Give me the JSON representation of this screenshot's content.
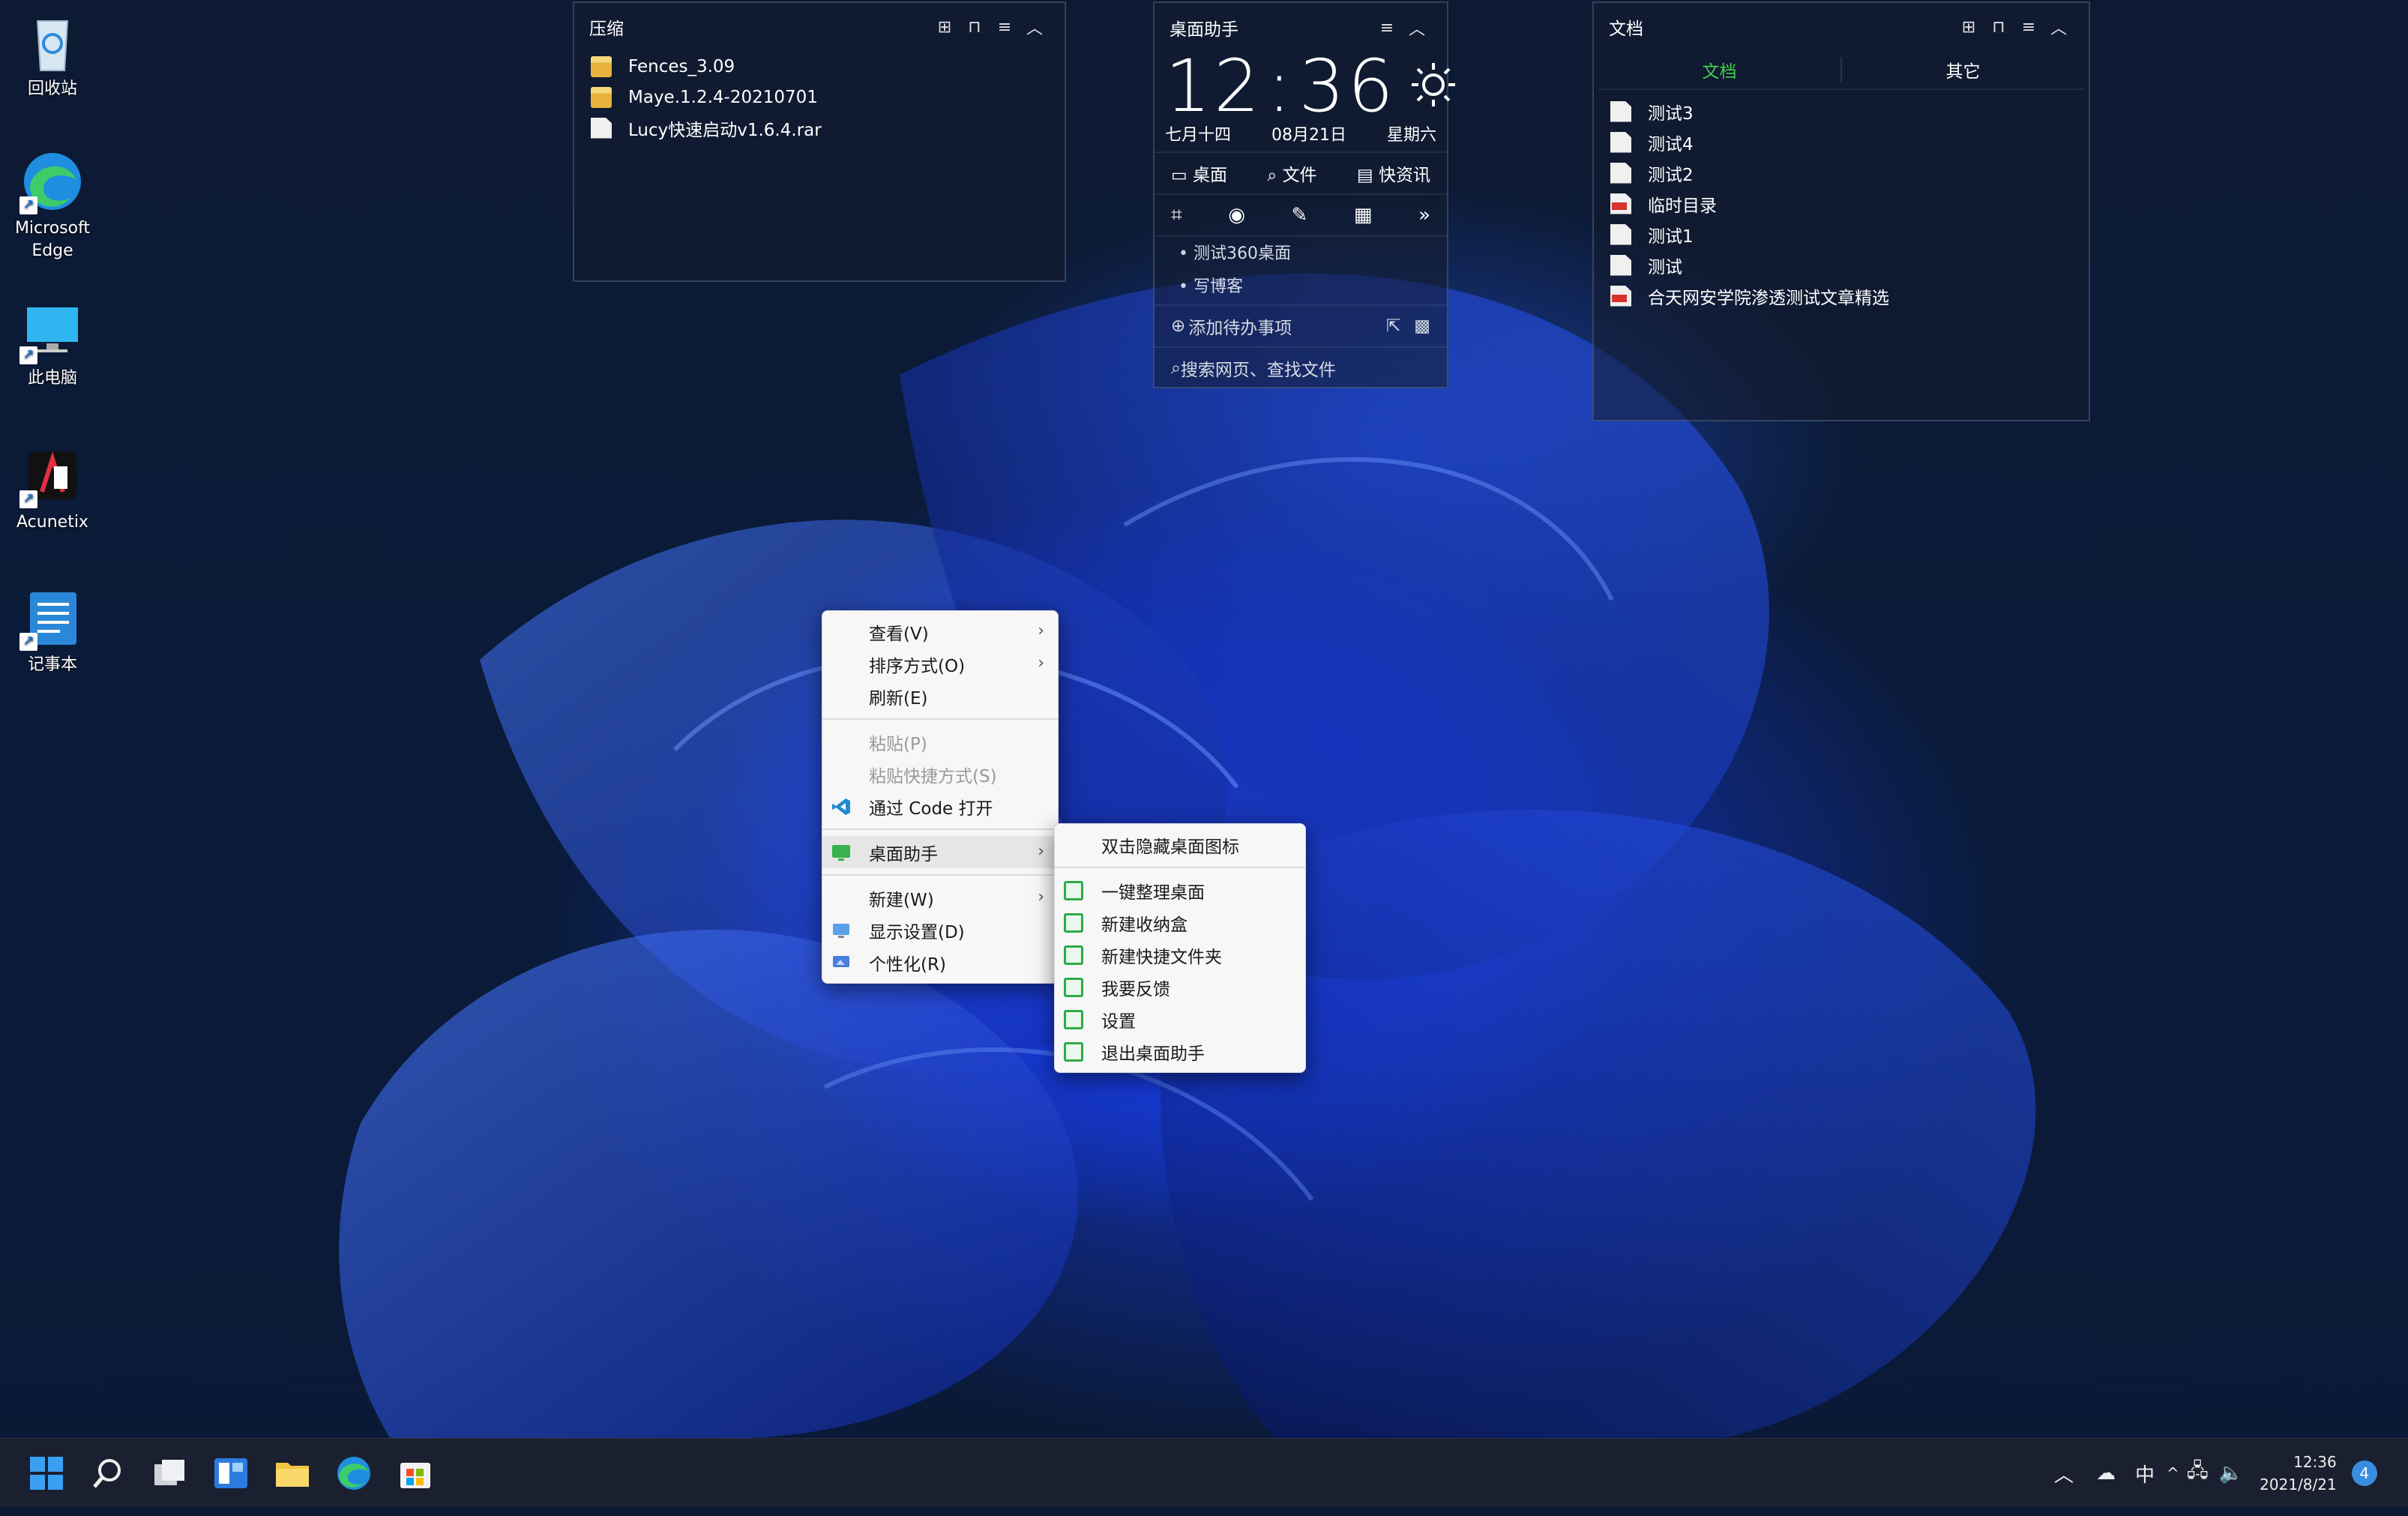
{
  "desktop_icons": [
    {
      "label": "回收站",
      "icon": "recycle-bin-icon"
    },
    {
      "label": "Microsoft Edge",
      "icon": "edge-icon"
    },
    {
      "label": "此电脑",
      "icon": "computer-icon"
    },
    {
      "label": "Acunetix",
      "icon": "acunetix-icon"
    },
    {
      "label": "记事本",
      "icon": "notepad-icon"
    }
  ],
  "fence_compress": {
    "title": "压缩",
    "items": [
      {
        "name": "Fences_3.09",
        "type": "folder"
      },
      {
        "name": "Maye.1.2.4-20210701",
        "type": "folder"
      },
      {
        "name": "Lucy快速启动v1.6.4.rar",
        "type": "file"
      }
    ]
  },
  "helper": {
    "title": "桌面助手",
    "hour": "12",
    "colon": ":",
    "minute": "36",
    "lunar": "七月十四",
    "date": "08月21日",
    "weekday": "星期六",
    "tabs": {
      "desktop": "桌面",
      "file": "文件",
      "news": "快资讯"
    },
    "todos": [
      "测试360桌面",
      "写博客"
    ],
    "add_todo": "添加待办事项",
    "search_placeholder": "搜索网页、查找文件"
  },
  "fence_docs": {
    "title": "文档",
    "tab_docs": "文档",
    "tab_other": "其它",
    "accent": "#3fcf4e",
    "items": [
      {
        "name": "测试3",
        "type": "doc"
      },
      {
        "name": "测试4",
        "type": "doc"
      },
      {
        "name": "测试2",
        "type": "doc"
      },
      {
        "name": "临时目录",
        "type": "pdf"
      },
      {
        "name": "测试1",
        "type": "doc"
      },
      {
        "name": "测试",
        "type": "doc"
      },
      {
        "name": "合天网安学院渗透测试文章精选",
        "type": "pdf"
      }
    ]
  },
  "context_menu": {
    "view": "查看(V)",
    "sort": "排序方式(O)",
    "refresh": "刷新(E)",
    "paste": "粘贴(P)",
    "paste_shortcut": "粘贴快捷方式(S)",
    "open_code": "通过 Code 打开",
    "desktop_helper": "桌面助手",
    "new": "新建(W)",
    "display": "显示设置(D)",
    "personalize": "个性化(R)"
  },
  "submenu": {
    "dblclick_hide": "双击隐藏桌面图标",
    "organize": "一键整理桌面",
    "new_box": "新建收纳盒",
    "new_shortcut_folder": "新建快捷文件夹",
    "feedback": "我要反馈",
    "settings": "设置",
    "exit": "退出桌面助手"
  },
  "taskbar": {
    "ime": "中",
    "time": "12:36",
    "date": "2021/8/21",
    "notifications": "4",
    "apps": [
      "start-icon",
      "search-icon",
      "task-view-icon",
      "widgets-icon",
      "file-explorer-icon",
      "edge-icon",
      "store-icon"
    ]
  }
}
